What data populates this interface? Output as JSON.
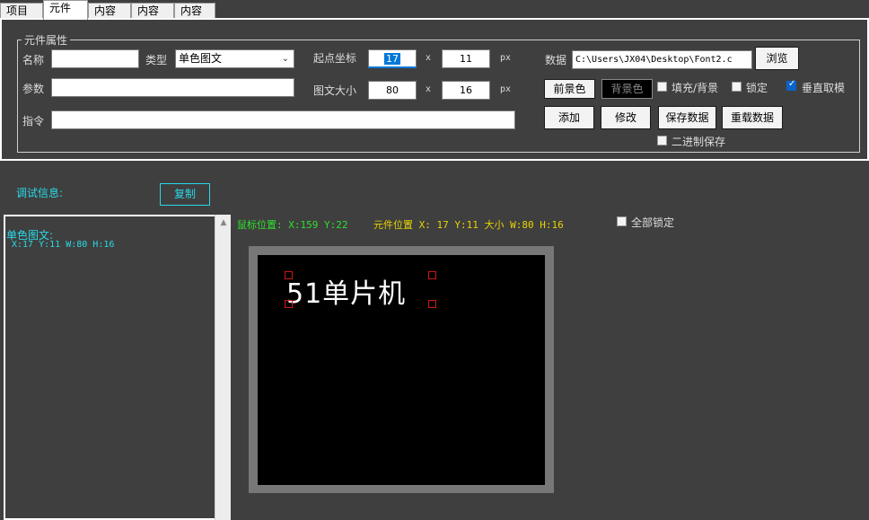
{
  "tabs": [
    "项目",
    "元件",
    "内容",
    "内容",
    "内容"
  ],
  "groupbox": {
    "title": "元件属性",
    "name_label": "名称",
    "name_value": "",
    "type_label": "类型",
    "type_value": "单色图文",
    "param_label": "参数",
    "param_value": "",
    "cmd_label": "指令",
    "cmd_value": "",
    "start_label": "起点坐标",
    "start_x": "17",
    "start_y": "11",
    "size_label": "图文大小",
    "size_w": "80",
    "size_h": "16",
    "x_sep": "x",
    "unit": "px",
    "data_label": "数据",
    "data_path": "C:\\Users\\JX04\\Desktop\\Font2.c",
    "browse": "浏览",
    "fg_btn": "前景色",
    "bg_btn": "背景色",
    "fill_bg": "填充/背景",
    "lock": "锁定",
    "vertical": "垂直取模",
    "add": "添加",
    "modify": "修改",
    "save_data": "保存数据",
    "reload_data": "重载数据",
    "binary_save": "二进制保存"
  },
  "states": {
    "fill_bg_checked": false,
    "lock_checked": false,
    "vertical_checked": true,
    "binary_save_checked": false,
    "all_lock_checked": false
  },
  "debug": {
    "title": "调试信息:",
    "copy": "复制",
    "line1": "单色图文:",
    "line2": "X:17 Y:11 W:80 H:16"
  },
  "status": {
    "mouse": "鼠标位置:  X:159 Y:22",
    "element": "元件位置 X: 17 Y:11 大小 W:80 H:16",
    "all_lock": "全部锁定"
  },
  "canvas": {
    "text": "51单片机"
  },
  "colors": {
    "accent_cyan": "#29d9e6",
    "mouse_green": "#2ee02e",
    "element_yellow": "#e8d400",
    "handle_red": "#d01616"
  }
}
